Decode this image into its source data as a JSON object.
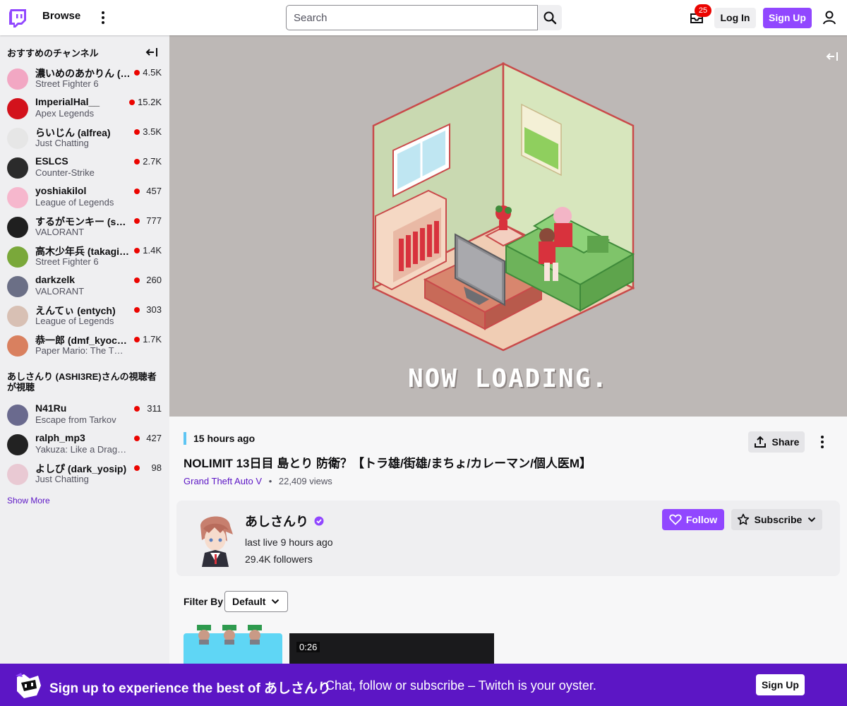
{
  "topbar": {
    "browse_label": "Browse",
    "search_placeholder": "Search",
    "inbox_count": "25",
    "login_label": "Log In",
    "signup_label": "Sign Up",
    "brand_color": "#9147ff"
  },
  "sidebar": {
    "recommended_header": "おすすめのチャンネル",
    "recommended": [
      {
        "name": "濃いめのあかりん (…",
        "game": "Street Fighter 6",
        "viewers": "4.5K",
        "avatar_color": "#f2a7c3"
      },
      {
        "name": "ImperialHal__",
        "game": "Apex Legends",
        "viewers": "15.2K",
        "avatar_color": "#d3121c"
      },
      {
        "name": "らいじん (alfrea)",
        "game": "Just Chatting",
        "viewers": "3.5K",
        "avatar_color": "#e6e6e6"
      },
      {
        "name": "ESLCS",
        "game": "Counter-Strike",
        "viewers": "2.7K",
        "avatar_color": "#2b2b2b"
      },
      {
        "name": "yoshiakilol",
        "game": "League of Legends",
        "viewers": "457",
        "avatar_color": "#f6b7cd"
      },
      {
        "name": "するがモンキー (s…",
        "game": "VALORANT",
        "viewers": "777",
        "avatar_color": "#1f1f1f"
      },
      {
        "name": "高木少年兵 (takagi…",
        "game": "Street Fighter 6",
        "viewers": "1.4K",
        "avatar_color": "#7aa83a"
      },
      {
        "name": "darkzelk",
        "game": "VALORANT",
        "viewers": "260",
        "avatar_color": "#6b6f86"
      },
      {
        "name": "えんてぃ (entych)",
        "game": "League of Legends",
        "viewers": "303",
        "avatar_color": "#d8c0b4"
      },
      {
        "name": "恭一郎 (dmf_kyoc…",
        "game": "Paper Mario: The T…",
        "viewers": "1.7K",
        "avatar_color": "#d9805f"
      }
    ],
    "viewers_also_header": "あしさんり (ASHI3RE)さんの視聴者が視聴",
    "viewers_also": [
      {
        "name": "N41Ru",
        "game": "Escape from Tarkov",
        "viewers": "311",
        "avatar_color": "#6a6a8e"
      },
      {
        "name": "ralph_mp3",
        "game": "Yakuza: Like a Dragon",
        "viewers": "427",
        "avatar_color": "#222222"
      },
      {
        "name": "よしぴ (dark_yosip)",
        "game": "Just Chatting",
        "viewers": "98",
        "avatar_color": "#e9c9d3"
      }
    ],
    "show_more_label": "Show More"
  },
  "player": {
    "loading_text": "NOW LOADING."
  },
  "video": {
    "time_ago": "15 hours ago",
    "share_label": "Share",
    "title": "NOLIMIT 13日目 島とり 防衛？【トラ雄/街雄/まちょ/カレーマン/個人医M】",
    "game": "Grand Theft Auto V",
    "separator": "•",
    "views": "22,409 views"
  },
  "channel": {
    "name": "あしさんり",
    "last_live": "last live 9 hours ago",
    "followers": "29.4K followers",
    "follow_label": "Follow",
    "subscribe_label": "Subscribe"
  },
  "filter": {
    "label": "Filter By",
    "selected": "Default"
  },
  "thumbnails": {
    "second_duration": "0:26"
  },
  "banner": {
    "title": "Sign up to experience the best of あしさんり",
    "subtitle": "Chat, follow or subscribe – Twitch is your oyster.",
    "signup_label": "Sign Up",
    "color": "#5c16c5"
  }
}
